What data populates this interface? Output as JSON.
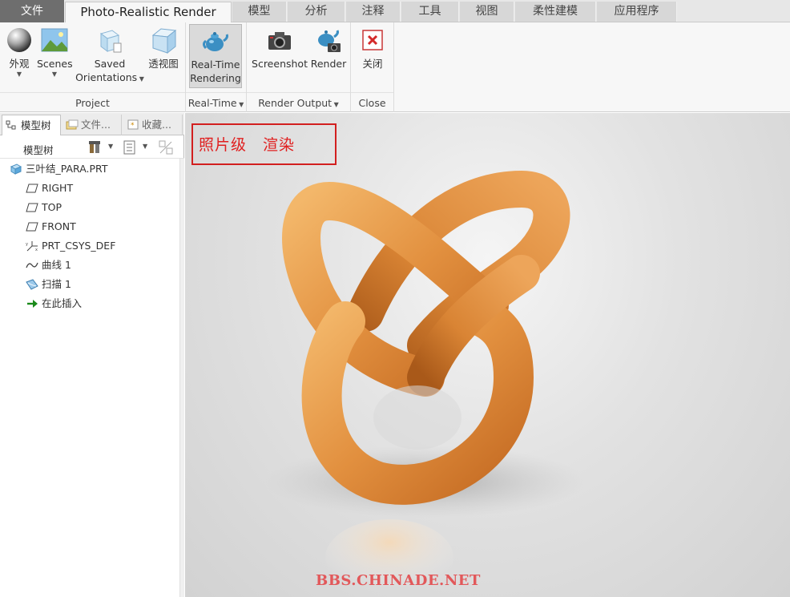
{
  "tabs": {
    "file": "文件",
    "active": "Photo-Realistic Render",
    "items": [
      "模型",
      "分析",
      "注释",
      "工具",
      "视图",
      "柔性建模",
      "应用程序"
    ]
  },
  "ribbon": {
    "project": {
      "label": "Project",
      "appearance": "外观",
      "scenes": "Scenes",
      "saved_orientations_1": "Saved",
      "saved_orientations_2": "Orientations",
      "perspective": "透视图"
    },
    "realtime": {
      "label": "Real-Time",
      "button_1": "Real-Time",
      "button_2": "Rendering"
    },
    "render_output": {
      "label": "Render Output",
      "screenshot": "Screenshot",
      "render": "Render"
    },
    "close": {
      "label": "Close",
      "button": "关闭"
    }
  },
  "left_panel": {
    "tabs": [
      "模型树",
      "文件...",
      "收藏..."
    ],
    "tree_title": "模型树",
    "tree_items": [
      {
        "label": "三叶结_PARA.PRT",
        "icon": "part-icon"
      },
      {
        "label": "RIGHT",
        "icon": "datum-plane-icon"
      },
      {
        "label": "TOP",
        "icon": "datum-plane-icon"
      },
      {
        "label": "FRONT",
        "icon": "datum-plane-icon"
      },
      {
        "label": "PRT_CSYS_DEF",
        "icon": "coordinate-system-icon"
      },
      {
        "label": "曲线 1",
        "icon": "curve-icon"
      },
      {
        "label": "扫描 1",
        "icon": "sweep-icon"
      },
      {
        "label": "在此插入",
        "icon": "insert-here-arrow-icon"
      }
    ]
  },
  "viewport": {
    "annotation": "照片级　渲染",
    "watermark": "BBS.CHINADE.NET"
  },
  "colors": {
    "file_tab": "#6e6e6e",
    "annotation_red": "#e02020",
    "wood_orange": "#e8923a"
  }
}
